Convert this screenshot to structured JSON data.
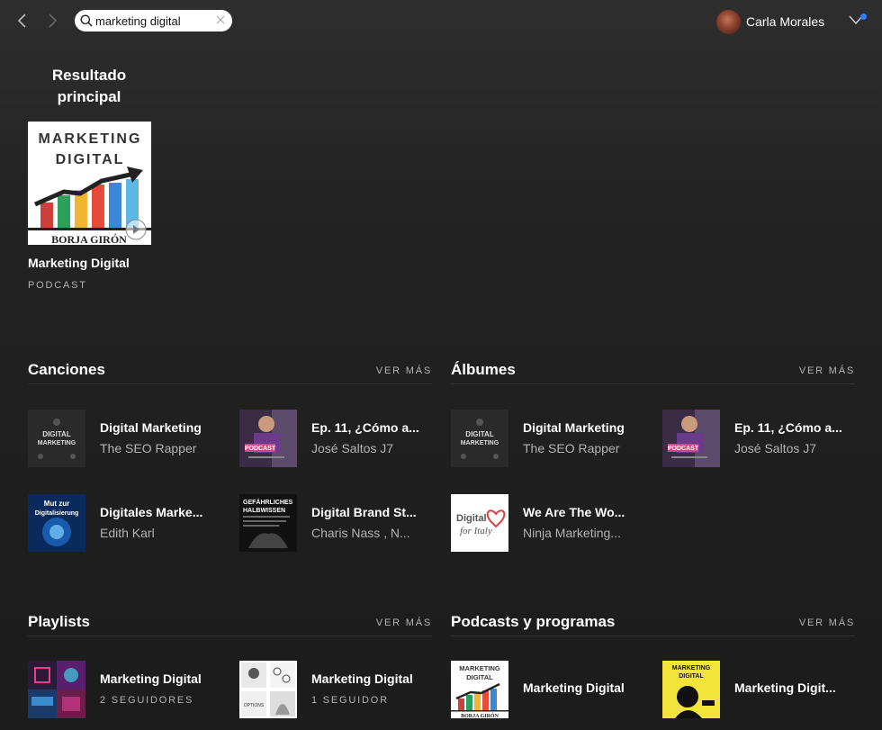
{
  "search": {
    "query": "marketing digital"
  },
  "user": {
    "name": "Carla Morales"
  },
  "top_result": {
    "heading": "Resultado principal",
    "title": "Marketing Digital",
    "type": "PODCAST",
    "cover_lines": [
      "MARKETING",
      "DIGITAL"
    ],
    "cover_author": "BORJA GIRÓN"
  },
  "songs": {
    "title": "Canciones",
    "more": "VER MÁS",
    "items": [
      {
        "title": "Digital Marketing",
        "subtitle": "The SEO Rapper"
      },
      {
        "title": "Ep. 11, ¿Cómo a...",
        "subtitle": "José Saltos J7"
      },
      {
        "title": "Digitales Marke...",
        "subtitle": "Edith Karl"
      },
      {
        "title": "Digital Brand St...",
        "subtitle": "Charis Nass , N..."
      }
    ]
  },
  "albums": {
    "title": "Álbumes",
    "more": "VER MÁS",
    "items": [
      {
        "title": "Digital Marketing",
        "subtitle": "The SEO Rapper"
      },
      {
        "title": "Ep. 11, ¿Cómo a...",
        "subtitle": "José Saltos J7"
      },
      {
        "title": "We Are The Wo...",
        "subtitle": "Ninja Marketing..."
      }
    ]
  },
  "playlists": {
    "title": "Playlists",
    "more": "VER MÁS",
    "items": [
      {
        "title": "Marketing Digital",
        "subtitle": "2 SEGUIDORES"
      },
      {
        "title": "Marketing Digital",
        "subtitle": "1 SEGUIDOR"
      }
    ]
  },
  "podcasts": {
    "title": "Podcasts y programas",
    "more": "VER MÁS",
    "items": [
      {
        "title": "Marketing Digital"
      },
      {
        "title": "Marketing Digit..."
      }
    ]
  },
  "colors": {
    "background": "#222222",
    "secondary_text": "#b3b3b3",
    "notification": "#2d7ff9"
  }
}
